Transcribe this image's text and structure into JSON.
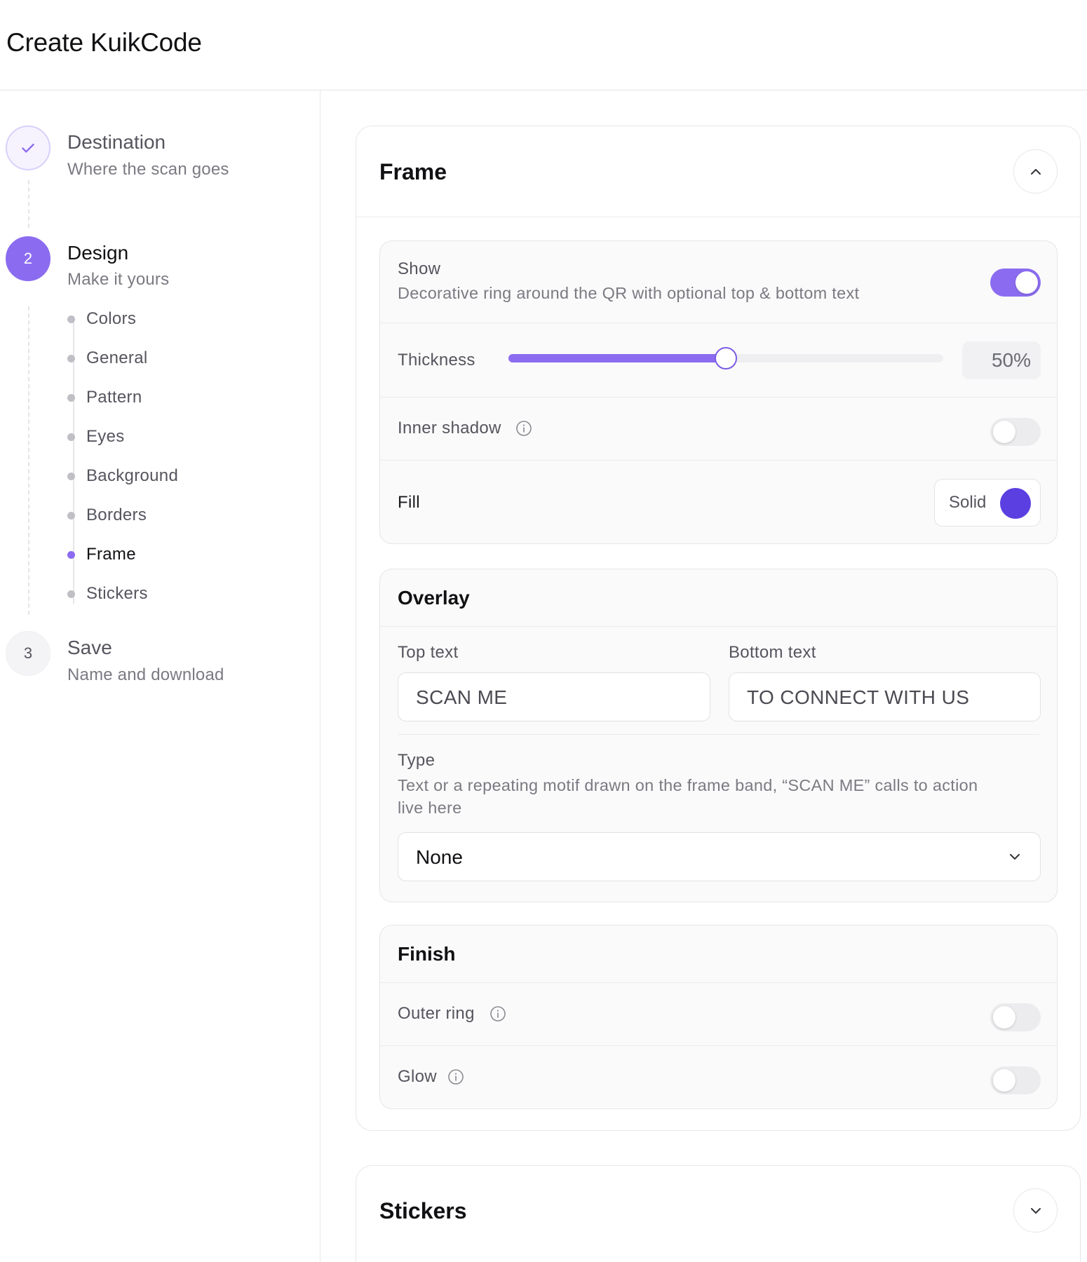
{
  "app": {
    "title": "Create KuikCode"
  },
  "steps": [
    {
      "number": "",
      "title": "Destination",
      "subtitle": "Where the scan goes",
      "status": "done"
    },
    {
      "number": "2",
      "title": "Design",
      "subtitle": "Make it yours",
      "status": "active"
    },
    {
      "number": "3",
      "title": "Save",
      "subtitle": "Name and download",
      "status": "todo"
    }
  ],
  "design_substeps": [
    "Colors",
    "General",
    "Pattern",
    "Eyes",
    "Background",
    "Borders",
    "Frame",
    "Stickers"
  ],
  "active_substep": "Frame",
  "frame_section": {
    "title": "Frame",
    "expanded": true,
    "show": {
      "label": "Show",
      "description": "Decorative ring around the QR with optional top & bottom text",
      "enabled": true
    },
    "thickness": {
      "label": "Thickness",
      "value_label": "50%",
      "value": 0.5
    },
    "inner_shadow": {
      "label": "Inner shadow",
      "enabled": false
    },
    "fill": {
      "label": "Fill",
      "mode": "Solid",
      "color": "#5b3fe0"
    }
  },
  "overlay": {
    "title": "Overlay",
    "top_text": {
      "label": "Top text",
      "value": "SCAN ME"
    },
    "bottom_text": {
      "label": "Bottom text",
      "value": "TO CONNECT WITH US"
    },
    "type": {
      "label": "Type",
      "description_line1": "Text or a repeating motif drawn on the frame band, “SCAN ME” calls to action",
      "description_line2": "live here",
      "selected": "None"
    }
  },
  "finish": {
    "title": "Finish",
    "outer_ring": {
      "label": "Outer ring",
      "enabled": false
    },
    "glow": {
      "label": "Glow",
      "enabled": false
    }
  },
  "stickers_section": {
    "title": "Stickers",
    "expanded": false
  },
  "icons": {
    "step_done": "check-icon",
    "collapse": "chevron-up-icon",
    "expand": "chevron-down-icon",
    "info": "info-icon",
    "select": "chevron-down-icon"
  },
  "colors": {
    "accent": "#8b6cf0",
    "fill_swatch": "#5b3fe0",
    "border": "#e6e6ea"
  }
}
